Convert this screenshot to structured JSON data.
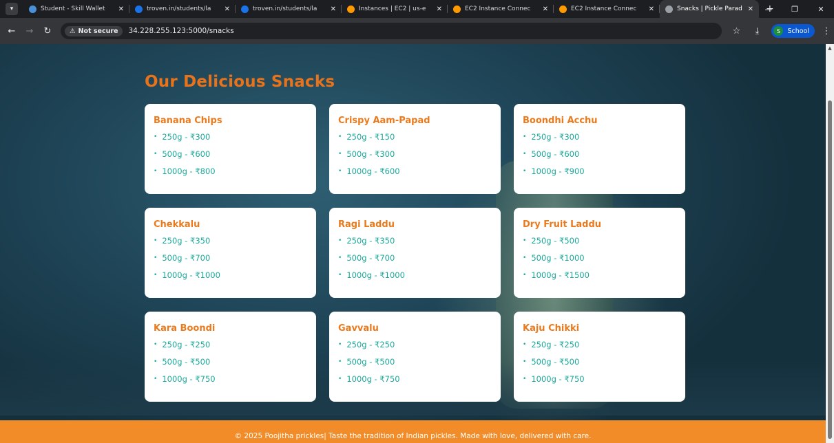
{
  "browser": {
    "tabs": [
      {
        "title": "Student - Skill Wallet",
        "favicon_color": "#4a90d9"
      },
      {
        "title": "troven.in/students/la",
        "favicon_color": "#1a73e8"
      },
      {
        "title": "troven.in/students/la",
        "favicon_color": "#1a73e8"
      },
      {
        "title": "Instances | EC2 | us-e",
        "favicon_color": "#ff9900"
      },
      {
        "title": "EC2 Instance Connec",
        "favicon_color": "#ff9900"
      },
      {
        "title": "EC2 Instance Connec",
        "favicon_color": "#ff9900"
      },
      {
        "title": "Snacks | Pickle Parad",
        "favicon_color": "#9aa0a6",
        "active": true
      }
    ],
    "security_label": "Not secure",
    "url": "34.228.255.123:5000/snacks",
    "profile_initial": "S",
    "profile_label": "School"
  },
  "page": {
    "heading": "Our Delicious Snacks",
    "products": [
      {
        "name": "Banana Chips",
        "prices": [
          "250g - ₹300",
          "500g - ₹600",
          "1000g - ₹800"
        ]
      },
      {
        "name": "Crispy Aam-Papad",
        "prices": [
          "250g - ₹150",
          "500g - ₹300",
          "1000g - ₹600"
        ]
      },
      {
        "name": "Boondhi Acchu",
        "prices": [
          "250g - ₹300",
          "500g - ₹600",
          "1000g - ₹900"
        ]
      },
      {
        "name": "Chekkalu",
        "prices": [
          "250g - ₹350",
          "500g - ₹700",
          "1000g - ₹1000"
        ]
      },
      {
        "name": "Ragi Laddu",
        "prices": [
          "250g - ₹350",
          "500g - ₹700",
          "1000g - ₹1000"
        ]
      },
      {
        "name": "Dry Fruit Laddu",
        "prices": [
          "250g - ₹500",
          "500g - ₹1000",
          "1000g - ₹1500"
        ]
      },
      {
        "name": "Kara Boondi",
        "prices": [
          "250g - ₹250",
          "500g - ₹500",
          "1000g - ₹750"
        ]
      },
      {
        "name": "Gavvalu",
        "prices": [
          "250g - ₹250",
          "500g - ₹500",
          "1000g - ₹750"
        ]
      },
      {
        "name": "Kaju Chikki",
        "prices": [
          "250g - ₹250",
          "500g - ₹500",
          "1000g - ₹750"
        ]
      }
    ],
    "footer_text": "© 2025 Poojitha prickles| Taste the tradition of Indian pickles. Made with love, delivered with care.",
    "colors": {
      "heading": "#e8731a",
      "product_name": "#ea7a1c",
      "price_text": "#1aa89a",
      "footer_bg": "#f28c28"
    }
  }
}
